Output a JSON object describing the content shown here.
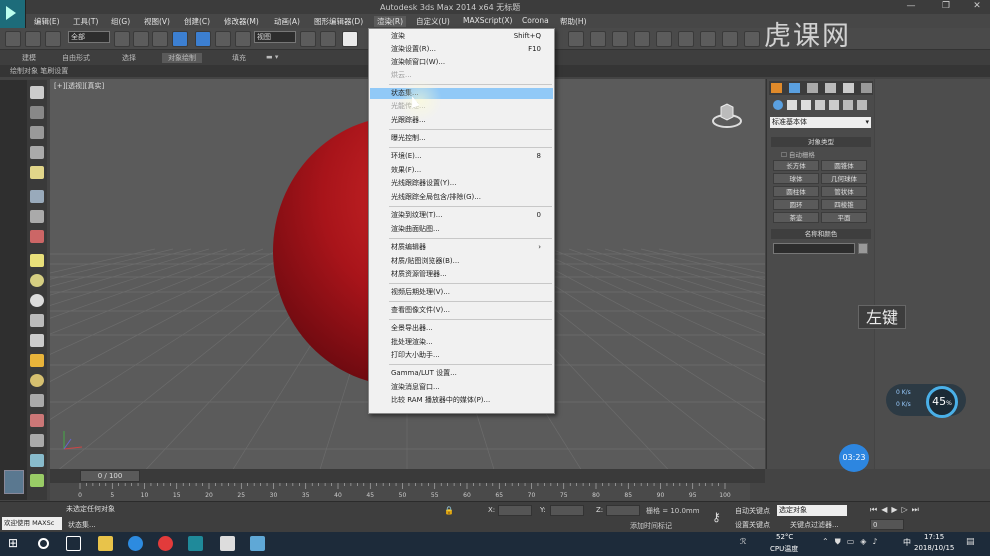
{
  "window": {
    "title": "Autodesk 3ds Max  2014 x64     无标题"
  },
  "menubar": {
    "items": [
      "编辑(E)",
      "工具(T)",
      "组(G)",
      "视图(V)",
      "创建(C)",
      "修改器(M)",
      "动画(A)",
      "图形编辑器(D)",
      "渲染(R)",
      "自定义(U)",
      "MAXScript(X)",
      "Corona",
      "帮助(H)"
    ]
  },
  "toolbar": {
    "selection_filter": "全部",
    "ref_coord": "视图"
  },
  "ribbon": {
    "tabs": [
      "建模",
      "自由形式",
      "选择",
      "对象绘制",
      "填充"
    ],
    "sub": "绘制对象  笔刷设置"
  },
  "viewport": {
    "label": "[+][透视][真实]"
  },
  "render_menu": {
    "items": [
      {
        "label": "渲染",
        "shortcut": "Shift+Q"
      },
      {
        "label": "渲染设置(R)...",
        "shortcut": "F10"
      },
      {
        "label": "渲染帧窗口(W)...",
        "shortcut": ""
      },
      {
        "label": "烘云...",
        "shortcut": ""
      },
      {
        "label": "状态集...",
        "shortcut": ""
      },
      {
        "label": "光能传递...",
        "shortcut": ""
      },
      {
        "label": "光跟踪器...",
        "shortcut": ""
      },
      {
        "label": "曝光控制...",
        "shortcut": ""
      },
      {
        "label": "环境(E)...",
        "shortcut": "8"
      },
      {
        "label": "效果(F)...",
        "shortcut": ""
      },
      {
        "label": "光线跟踪器设置(Y)...",
        "shortcut": ""
      },
      {
        "label": "光线跟踪全局包含/排除(G)...",
        "shortcut": ""
      },
      {
        "label": "渲染到纹理(T)...",
        "shortcut": "0"
      },
      {
        "label": "渲染曲面贴图...",
        "shortcut": ""
      },
      {
        "label": "材质编辑器",
        "shortcut": "›"
      },
      {
        "label": "材质/贴图浏览器(B)...",
        "shortcut": ""
      },
      {
        "label": "材质资源管理器...",
        "shortcut": ""
      },
      {
        "label": "视频后期处理(V)...",
        "shortcut": ""
      },
      {
        "label": "查看图像文件(V)...",
        "shortcut": ""
      },
      {
        "label": "全景导出器...",
        "shortcut": ""
      },
      {
        "label": "批处理渲染...",
        "shortcut": ""
      },
      {
        "label": "打印大小助手...",
        "shortcut": ""
      },
      {
        "label": "Gamma/LUT 设置...",
        "shortcut": ""
      },
      {
        "label": "渲染消息窗口...",
        "shortcut": ""
      },
      {
        "label": "比较 RAM 播放器中的媒体(P)...",
        "shortcut": ""
      }
    ],
    "highlighted": "状态集..."
  },
  "command_panel": {
    "dropdown": "标准基本体",
    "section_object_type": "对象类型",
    "autogrid": "自动栅格",
    "buttons": [
      "长方体",
      "圆锥体",
      "球体",
      "几何球体",
      "圆柱体",
      "管状体",
      "圆环",
      "四棱锥",
      "茶壶",
      "平面"
    ],
    "section_name_color": "名称和颜色"
  },
  "overlay": {
    "key_hint": "左键",
    "gauge_pct": "45",
    "gauge_unit": "%",
    "gauge_up": "0 K/s",
    "gauge_down": "0 K/s",
    "timer": "03:23",
    "watermark": "虎课网"
  },
  "timeline": {
    "frame": "0 / 100",
    "ticks": [
      "0",
      "5",
      "10",
      "15",
      "20",
      "25",
      "30",
      "35",
      "40",
      "45",
      "50",
      "55",
      "60",
      "65",
      "70",
      "75",
      "80",
      "85",
      "90",
      "95",
      "100"
    ]
  },
  "status": {
    "welcome": "欢迎使用 MAXSc",
    "selection": "未选定任何对象",
    "prompt": "状态集...",
    "x_label": "X:",
    "y_label": "Y:",
    "z_label": "Z:",
    "grid": "栅格 = 10.0mm",
    "autokey": "自动关键点",
    "autokey_sel": "选定对象",
    "setkey": "设置关键点",
    "keyfilter": "关键点过滤器...",
    "add_time_tag": "添加时间标记",
    "frame_field": "0"
  },
  "taskbar": {
    "temp": "52°C",
    "temp_label": "CPU温度",
    "time": "17:15",
    "date": "2018/10/15",
    "ime": "中"
  }
}
